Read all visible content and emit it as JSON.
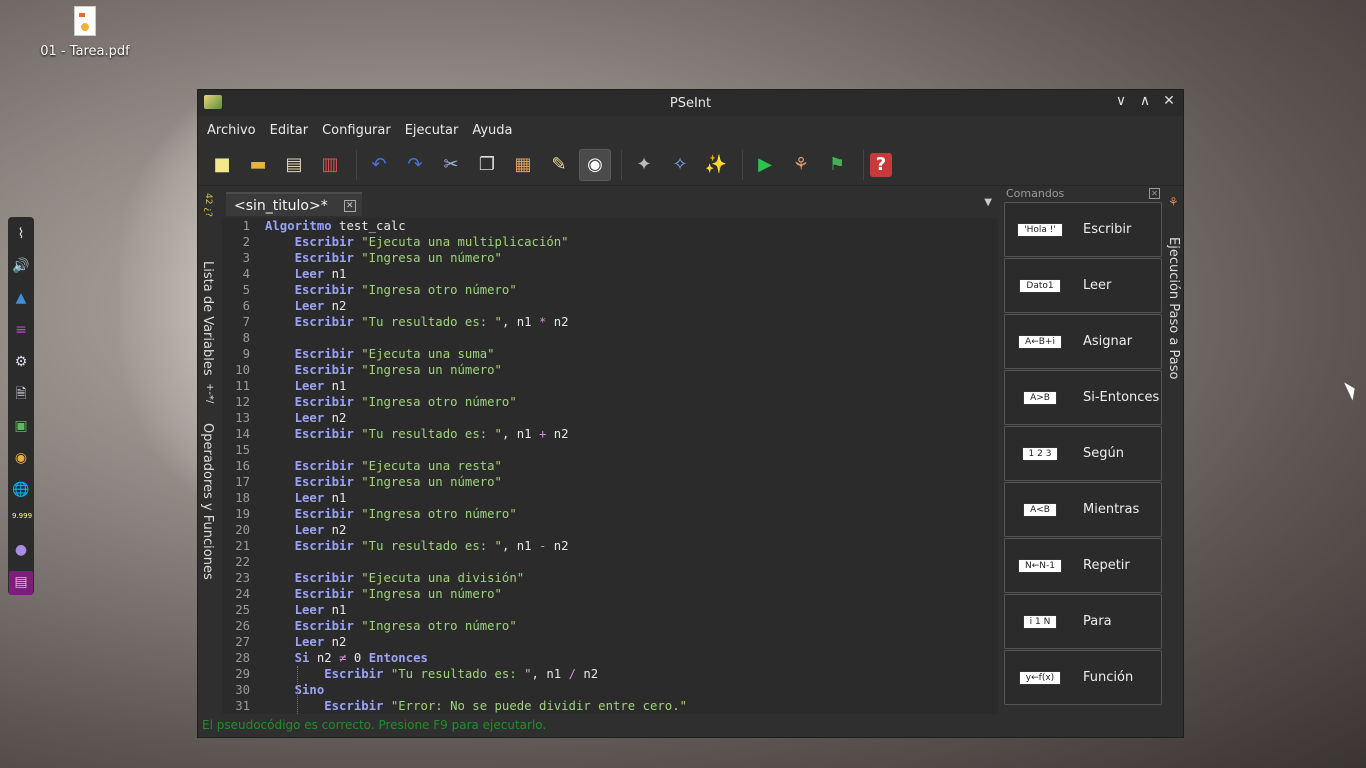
{
  "desktop": {
    "file_label": "01 - Tarea.pdf",
    "dock_icons": [
      "wifi-icon",
      "volume-icon",
      "arch-icon",
      "workspace-icon",
      "settings-icon",
      "document-icon",
      "terminal-icon",
      "chrome-icon",
      "globe-icon",
      "badge-app-icon",
      "privacy-icon",
      "pseint-icon"
    ],
    "dock_badge": "9.999"
  },
  "window": {
    "title": "PSeInt",
    "menu": [
      "Archivo",
      "Editar",
      "Configurar",
      "Ejecutar",
      "Ayuda"
    ],
    "toolbar_icons": [
      "new-file-icon",
      "open-folder-icon",
      "save-icon",
      "save-as-icon",
      "undo-icon",
      "redo-icon",
      "cut-icon",
      "copy-icon",
      "paste-icon",
      "edit-icon",
      "view-icon",
      "find-icon",
      "find-next-icon",
      "replace-icon",
      "run-icon",
      "step-icon",
      "debug-icon",
      "help-icon"
    ]
  },
  "side_panels": {
    "variables": "Lista de Variables",
    "operators": "Operadores y Funciones",
    "steps": "Ejecución Paso a Paso"
  },
  "editor": {
    "tab_label": "<sin_titulo>*",
    "lines": [
      {
        "n": "1",
        "code": "Algoritmo test_calc"
      },
      {
        "n": "2",
        "code": "    Escribir \"Ejecuta una multiplicación\""
      },
      {
        "n": "3",
        "code": "    Escribir \"Ingresa un número\""
      },
      {
        "n": "4",
        "code": "    Leer n1"
      },
      {
        "n": "5",
        "code": "    Escribir \"Ingresa otro número\""
      },
      {
        "n": "6",
        "code": "    Leer n2"
      },
      {
        "n": "7",
        "code": "    Escribir \"Tu resultado es: \", n1 * n2"
      },
      {
        "n": "8",
        "code": ""
      },
      {
        "n": "9",
        "code": "    Escribir \"Ejecuta una suma\""
      },
      {
        "n": "10",
        "code": "    Escribir \"Ingresa un número\""
      },
      {
        "n": "11",
        "code": "    Leer n1"
      },
      {
        "n": "12",
        "code": "    Escribir \"Ingresa otro número\""
      },
      {
        "n": "13",
        "code": "    Leer n2"
      },
      {
        "n": "14",
        "code": "    Escribir \"Tu resultado es: \", n1 + n2"
      },
      {
        "n": "15",
        "code": ""
      },
      {
        "n": "16",
        "code": "    Escribir \"Ejecuta una resta\""
      },
      {
        "n": "17",
        "code": "    Escribir \"Ingresa un número\""
      },
      {
        "n": "18",
        "code": "    Leer n1"
      },
      {
        "n": "19",
        "code": "    Escribir \"Ingresa otro número\""
      },
      {
        "n": "20",
        "code": "    Leer n2"
      },
      {
        "n": "21",
        "code": "    Escribir \"Tu resultado es: \", n1 - n2"
      },
      {
        "n": "22",
        "code": ""
      },
      {
        "n": "23",
        "code": "    Escribir \"Ejecuta una división\""
      },
      {
        "n": "24",
        "code": "    Escribir \"Ingresa un número\""
      },
      {
        "n": "25",
        "code": "    Leer n1"
      },
      {
        "n": "26",
        "code": "    Escribir \"Ingresa otro número\""
      },
      {
        "n": "27",
        "code": "    Leer n2"
      },
      {
        "n": "28",
        "code": "    Si n2 ≠ 0 Entonces"
      },
      {
        "n": "29",
        "code": "        Escribir \"Tu resultado es: \", n1 / n2"
      },
      {
        "n": "30",
        "code": "    Sino"
      },
      {
        "n": "31",
        "code": "        Escribir \"Error: No se puede dividir entre cero.\""
      }
    ],
    "status": "El pseudocódigo es correcto. Presione F9 para ejecutarlo."
  },
  "commands": {
    "header": "Comandos",
    "items": [
      {
        "label": "Escribir",
        "shape": "'Hola !'"
      },
      {
        "label": "Leer",
        "shape": "Dato1"
      },
      {
        "label": "Asignar",
        "shape": "A←B+i"
      },
      {
        "label": "Si-Entonces",
        "shape": "A>B"
      },
      {
        "label": "Según",
        "shape": "1 2 3"
      },
      {
        "label": "Mientras",
        "shape": "A<B"
      },
      {
        "label": "Repetir",
        "shape": "N←N-1"
      },
      {
        "label": "Para",
        "shape": "i 1 N"
      },
      {
        "label": "Función",
        "shape": "y←f(x)"
      }
    ]
  }
}
